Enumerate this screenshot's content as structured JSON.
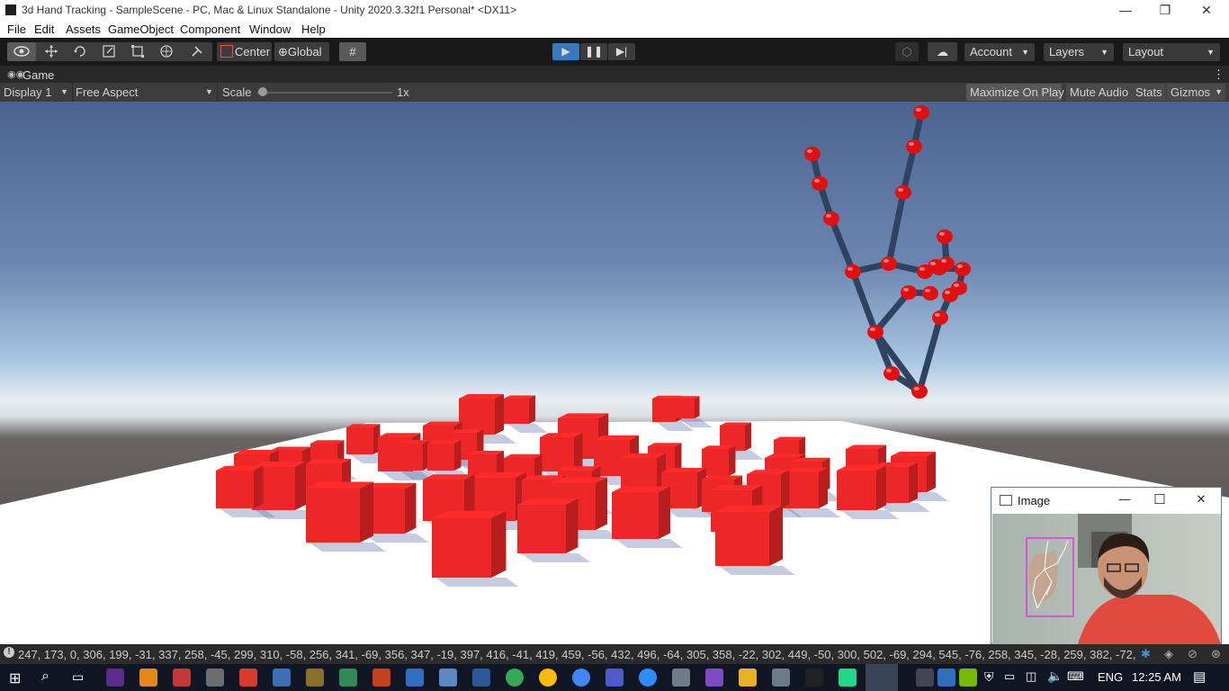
{
  "window": {
    "title": "3d Hand Tracking - SampleScene - PC, Mac & Linux Standalone - Unity 2020.3.32f1 Personal* <DX11>",
    "minimize_glyph": "—",
    "restore_glyph": "❐",
    "close_glyph": "✕"
  },
  "menu": [
    "File",
    "Edit",
    "Assets",
    "GameObject",
    "Component",
    "Window",
    "Help"
  ],
  "toolbar": {
    "pivot_label": "Center",
    "space_label": "Global",
    "account_label": "Account",
    "layers_label": "Layers",
    "layout_label": "Layout",
    "play_glyph": "▶",
    "pause_glyph": "❚❚",
    "step_glyph": "▶|"
  },
  "game_tab": {
    "tab_label": "Game",
    "display_label": "Display 1",
    "aspect_label": "Free Aspect",
    "scale_label": "Scale",
    "scale_value": "1x",
    "scale_slider_fraction": 0.02,
    "maximize_label": "Maximize On Play",
    "mute_label": "Mute Audio",
    "stats_label": "Stats",
    "gizmos_label": "Gizmos",
    "menu_glyph": "⋮"
  },
  "image_window": {
    "title": "Image",
    "minimize_glyph": "—",
    "maximize_glyph": "☐",
    "close_glyph": "✕"
  },
  "status": {
    "text": "247, 173, 0, 306, 199, -31, 337, 258, -45, 299, 310, -58, 256, 341, -69, 356, 347, -19, 397, 416, -41, 419, 459, -56, 432, 496, -64, 305, 358, -22, 302, 449, -50, 300, 502, -69, 294, 545, -76, 258, 345, -28, 259, 382, -72,"
  },
  "taskbar": {
    "language": "ENG",
    "time": "12:25 AM"
  },
  "colors": {
    "cube_red": "#ff2a2a",
    "joint_red": "#e01010",
    "bone_blue": "#2f4260",
    "play_active": "#3a79bb",
    "taskbar_bg": "#101623"
  }
}
